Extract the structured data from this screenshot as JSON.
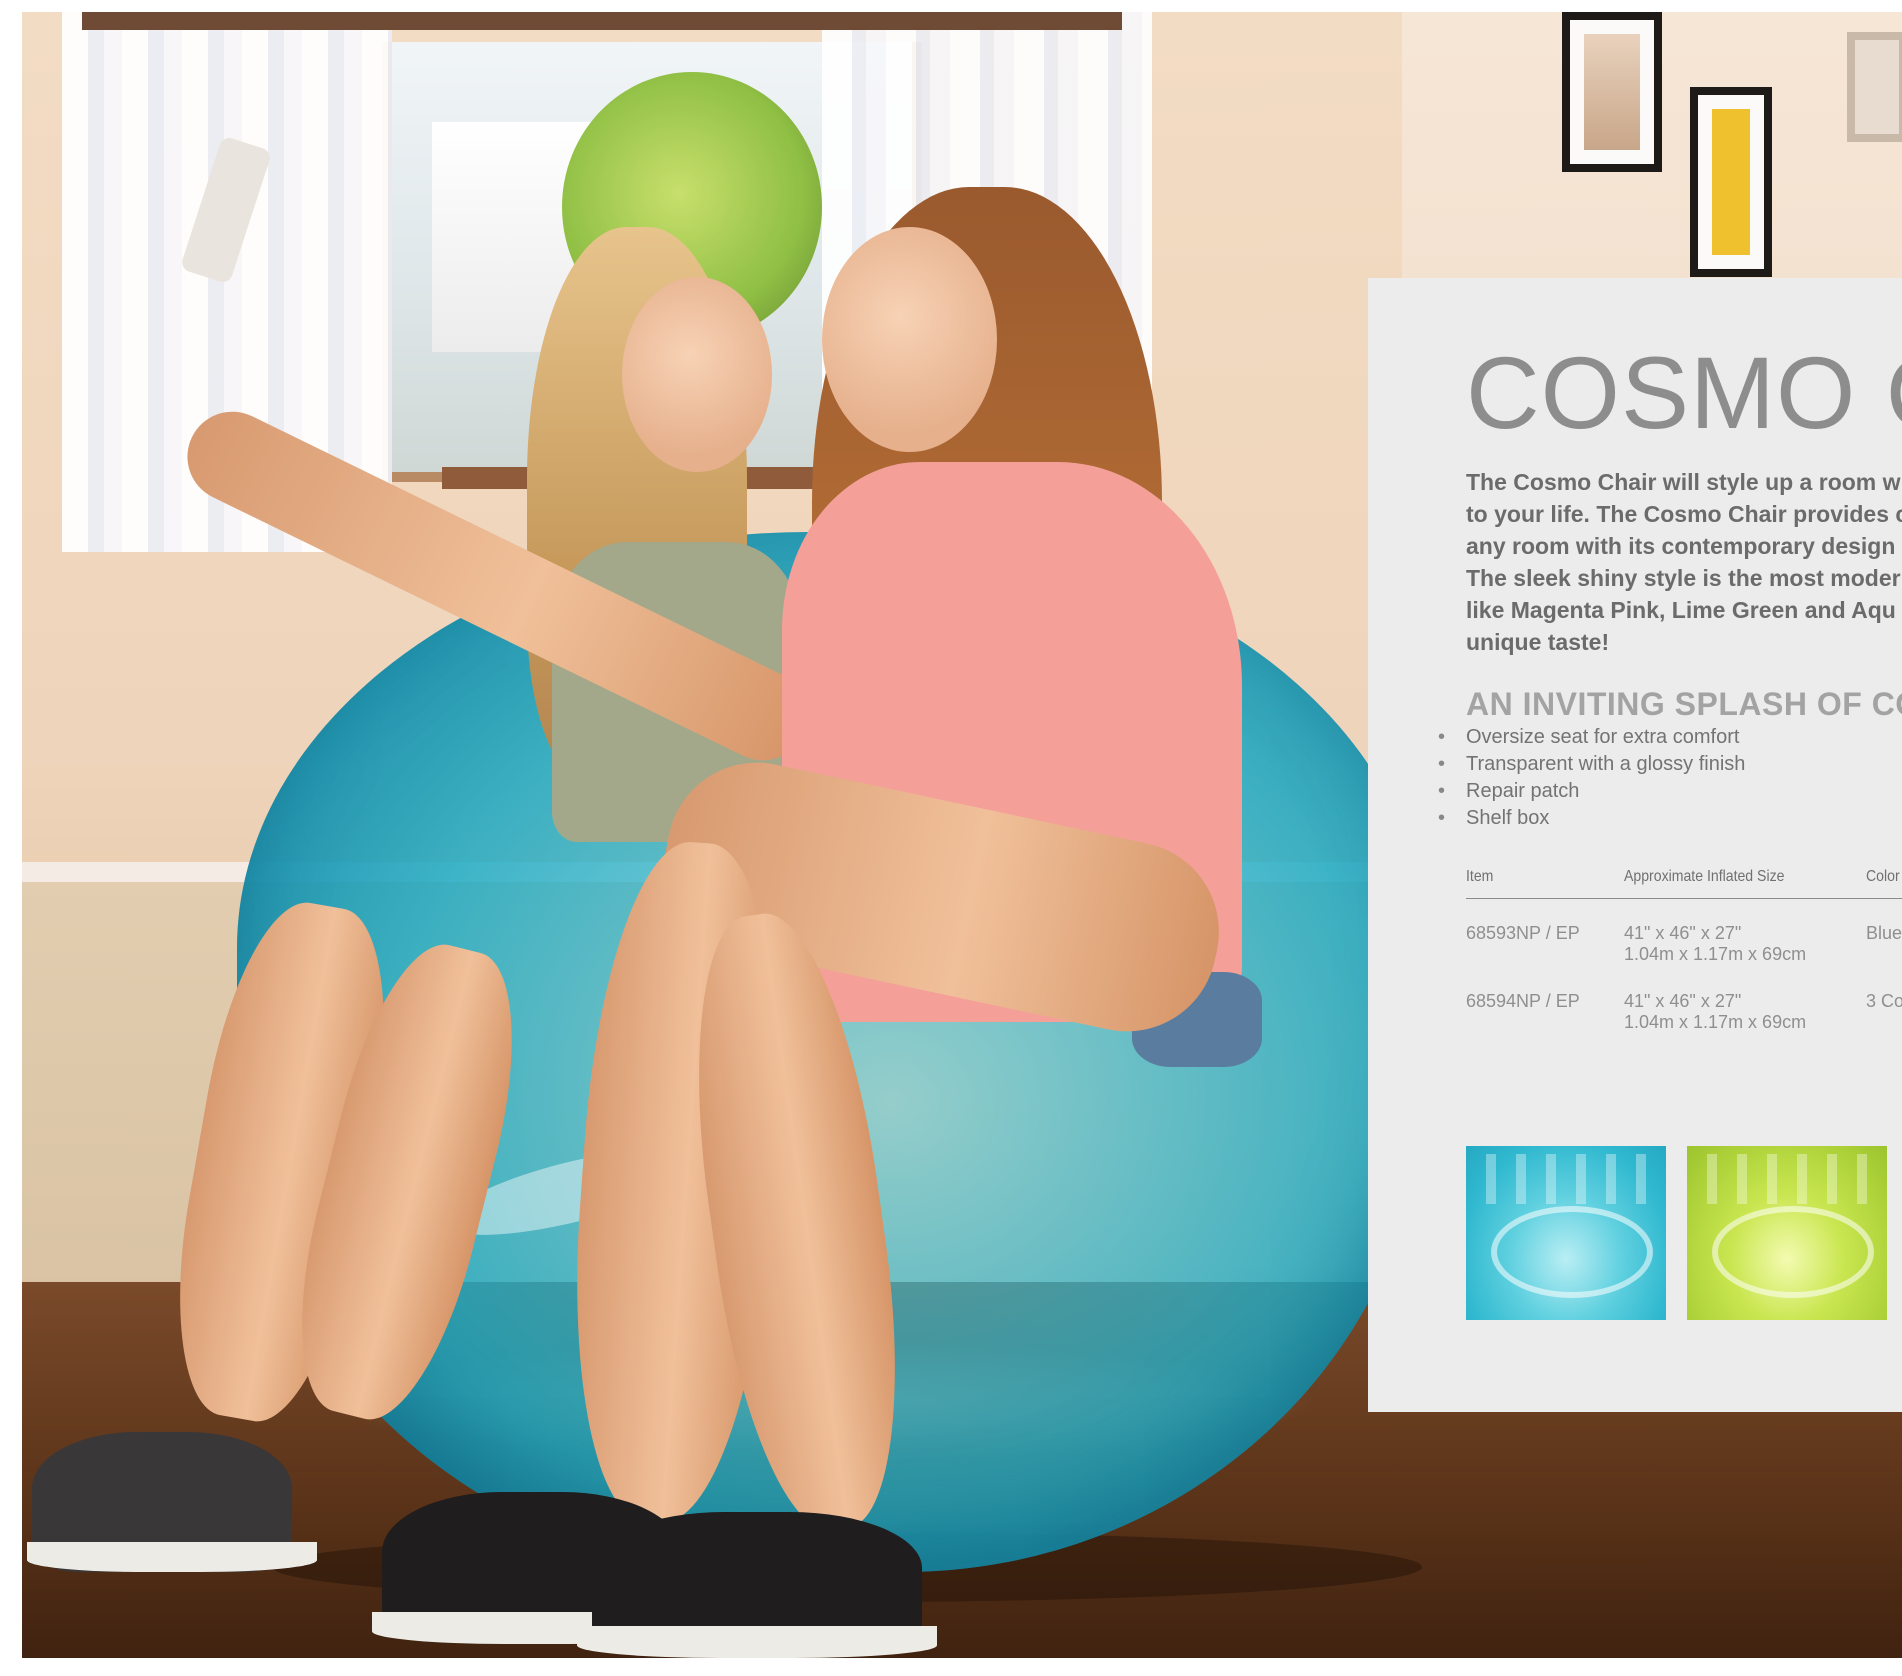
{
  "product": {
    "title": "COSMO C",
    "description_lines": [
      "The Cosmo Chair will style up a room w",
      "to your life. The Cosmo Chair provides c",
      "any room with its contemporary design",
      "The sleek shiny style is the most moder",
      "like Magenta Pink, Lime Green and Aqu",
      "unique taste!"
    ],
    "subheading": "AN INVITING SPLASH OF CO",
    "features": [
      "Oversize seat for extra comfort",
      "Transparent with a glossy finish",
      "Repair patch",
      "Shelf box"
    ],
    "bullet": "•"
  },
  "spec_table": {
    "headers": [
      "Item",
      "Approximate Inflated Size",
      "Color"
    ],
    "rows": [
      {
        "item": "68593NP / EP",
        "size_in": "41\" x 46\" x 27\"",
        "size_m": "1.04m x 1.17m x 69cm",
        "color": "Blue"
      },
      {
        "item": "68594NP / EP",
        "size_in": "41\" x 46\" x 27\"",
        "size_m": "1.04m x 1.17m x 69cm",
        "color": "3 Co"
      }
    ]
  },
  "swatches": [
    {
      "name": "blue",
      "color": "#35b9d0"
    },
    {
      "name": "lime-green",
      "color": "#b3d63c"
    }
  ],
  "photo": {
    "chair_color": "#2bb0c8",
    "floor_color": "#5c3419",
    "wall_color": "#f1d9c0"
  }
}
